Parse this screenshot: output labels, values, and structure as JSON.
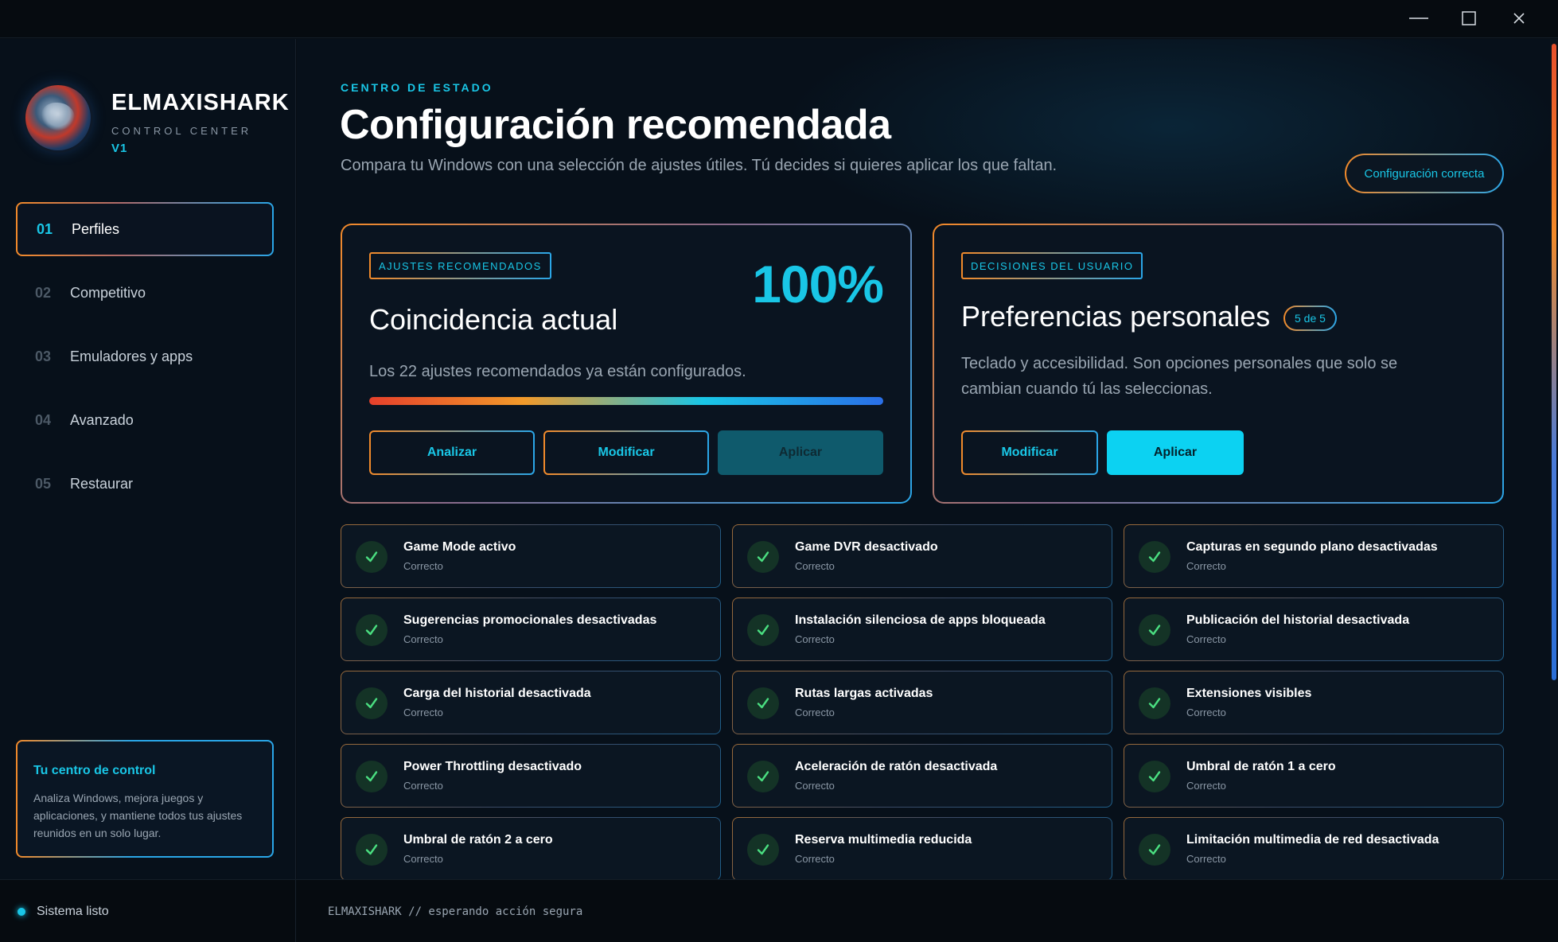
{
  "window": {
    "minimize_label": "Minimize",
    "maximize_label": "Maximize",
    "close_label": "Close"
  },
  "brand": {
    "name": "ELMAXISHARK",
    "subtitle": "CONTROL CENTER",
    "version": "V1"
  },
  "sidebar": {
    "items": [
      {
        "num": "01",
        "label": "Perfiles",
        "active": true
      },
      {
        "num": "02",
        "label": "Competitivo",
        "active": false
      },
      {
        "num": "03",
        "label": "Emuladores y apps",
        "active": false
      },
      {
        "num": "04",
        "label": "Avanzado",
        "active": false
      },
      {
        "num": "05",
        "label": "Restaurar",
        "active": false
      }
    ],
    "info_card": {
      "title": "Tu centro de control",
      "body": "Analiza Windows, mejora juegos y aplicaciones, y mantiene todos tus ajustes reunidos en un solo lugar."
    }
  },
  "statusbar": {
    "state": "Sistema listo",
    "log": "ELMAXISHARK // esperando acción segura"
  },
  "header": {
    "kicker": "CENTRO DE ESTADO",
    "title": "Configuración recomendada",
    "subtitle": "Compara tu Windows con una selección de ajustes útiles. Tú decides si quieres aplicar los que faltan.",
    "status_pill": "Configuración correcta"
  },
  "panel_recommended": {
    "tag": "AJUSTES RECOMENDADOS",
    "title": "Coincidencia actual",
    "percent": "100%",
    "progress_fraction": 1.0,
    "description": "Los 22 ajustes recomendados ya están configurados.",
    "buttons": {
      "analyze": "Analizar",
      "modify": "Modificar",
      "apply": "Aplicar"
    }
  },
  "panel_personal": {
    "tag": "DECISIONES DEL USUARIO",
    "title": "Preferencias personales",
    "count_badge": "5 de 5",
    "description": "Teclado y accesibilidad. Son opciones personales que solo se cambian cuando tú las seleccionas.",
    "buttons": {
      "modify": "Modificar",
      "apply": "Aplicar"
    }
  },
  "checks": [
    {
      "title": "Game Mode activo",
      "status": "Correcto"
    },
    {
      "title": "Game DVR desactivado",
      "status": "Correcto"
    },
    {
      "title": "Capturas en segundo plano desactivadas",
      "status": "Correcto"
    },
    {
      "title": "Sugerencias promocionales desactivadas",
      "status": "Correcto"
    },
    {
      "title": "Instalación silenciosa de apps bloqueada",
      "status": "Correcto"
    },
    {
      "title": "Publicación del historial desactivada",
      "status": "Correcto"
    },
    {
      "title": "Carga del historial desactivada",
      "status": "Correcto"
    },
    {
      "title": "Rutas largas activadas",
      "status": "Correcto"
    },
    {
      "title": "Extensiones visibles",
      "status": "Correcto"
    },
    {
      "title": "Power Throttling desactivado",
      "status": "Correcto"
    },
    {
      "title": "Aceleración de ratón desactivada",
      "status": "Correcto"
    },
    {
      "title": "Umbral de ratón 1 a cero",
      "status": "Correcto"
    },
    {
      "title": "Umbral de ratón 2 a cero",
      "status": "Correcto"
    },
    {
      "title": "Reserva multimedia reducida",
      "status": "Correcto"
    },
    {
      "title": "Limitación multimedia de red desactivada",
      "status": "Correcto"
    }
  ],
  "colors": {
    "accent": "#19c6e6",
    "success_check": "#4ade80",
    "background": "#07101a"
  }
}
